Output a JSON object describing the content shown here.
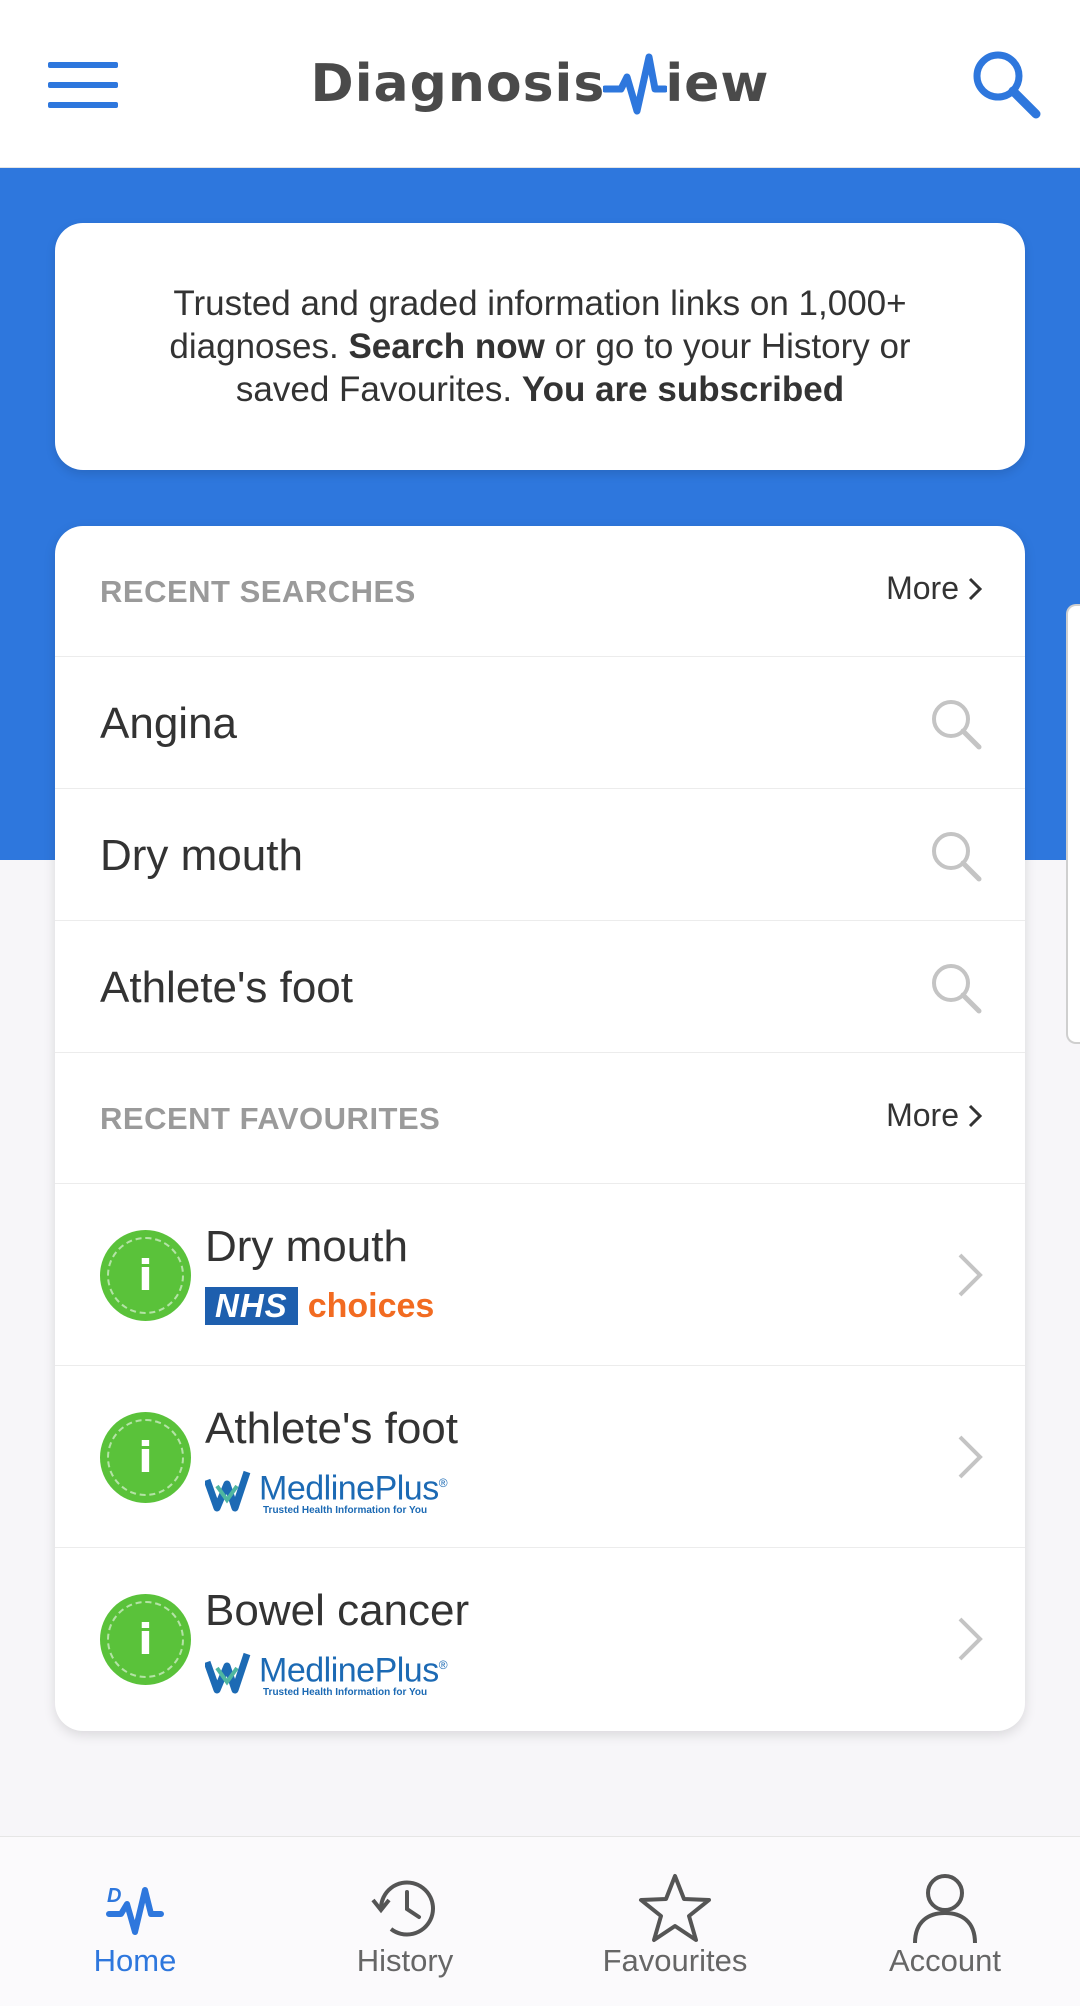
{
  "header": {
    "logo_left": "Diagnosis",
    "logo_right": "iew",
    "menu_icon": "hamburger-menu-icon",
    "search_icon": "search-icon"
  },
  "intro": {
    "text_1": "Trusted and graded information links on 1,000+ diagnoses. ",
    "bold_1": "Search now",
    "text_2": " or go to your History or saved Favourites. ",
    "bold_2": "You are subscribed"
  },
  "recent_searches": {
    "title": "RECENT SEARCHES",
    "more_label": "More",
    "items": [
      {
        "label": "Angina"
      },
      {
        "label": "Dry mouth"
      },
      {
        "label": "Athlete's foot"
      }
    ]
  },
  "recent_favourites": {
    "title": "RECENT FAVOURITES",
    "more_label": "More",
    "items": [
      {
        "label": "Dry mouth",
        "source": "nhs-choices",
        "badge": "i"
      },
      {
        "label": "Athlete's foot",
        "source": "medlineplus",
        "badge": "i"
      },
      {
        "label": "Bowel cancer",
        "source": "medlineplus",
        "badge": "i"
      }
    ]
  },
  "sources": {
    "nhs_box": "NHS",
    "nhs_word": "choices",
    "medline_name": "MedlinePlus",
    "medline_reg": "®",
    "medline_tag": "Trusted Health Information for You"
  },
  "nav": {
    "items": [
      {
        "label": "Home",
        "active": true
      },
      {
        "label": "History"
      },
      {
        "label": "Favourites"
      },
      {
        "label": "Account"
      }
    ]
  },
  "colors": {
    "brand_blue": "#2e77dd",
    "badge_green": "#5ac23a",
    "nhs_blue": "#1e5fae",
    "nhs_orange": "#f26b21",
    "medline_blue": "#1c6ab4"
  }
}
